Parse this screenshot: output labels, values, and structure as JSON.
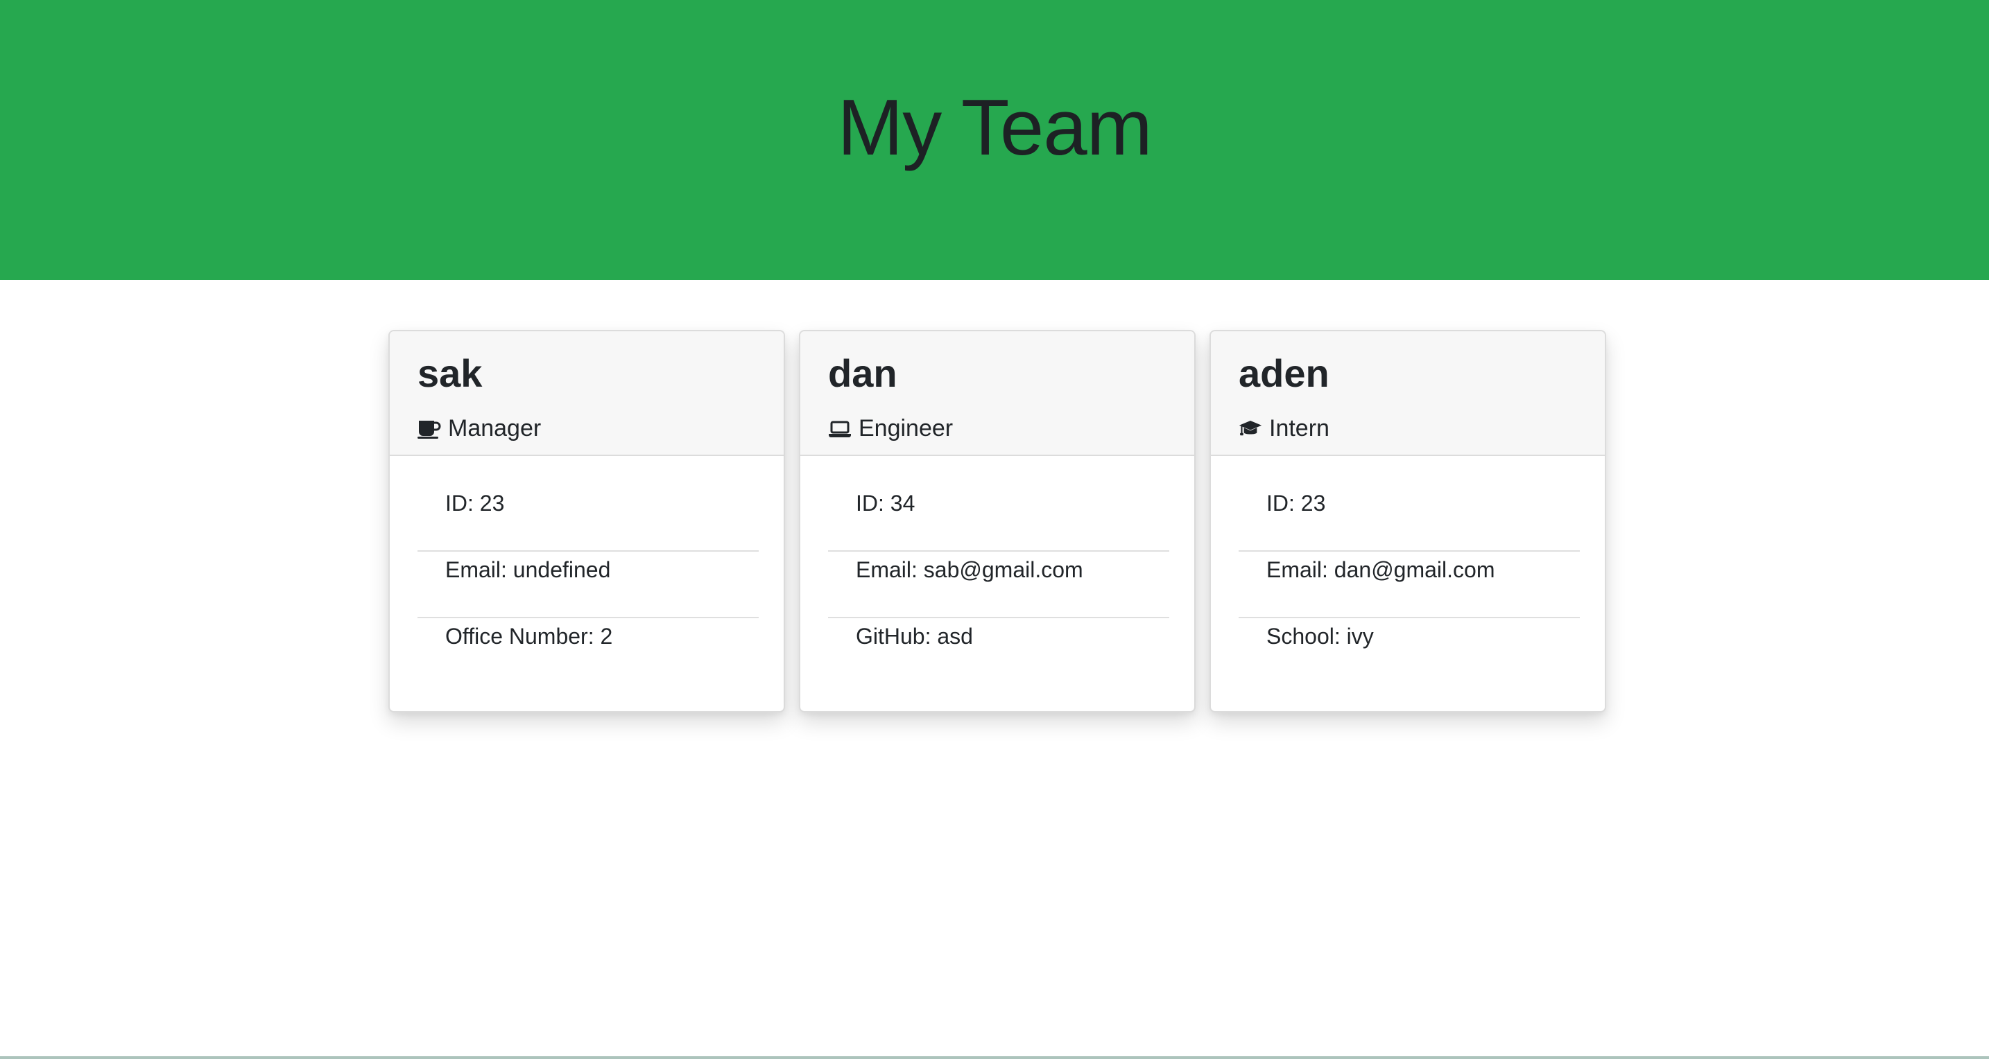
{
  "header": {
    "title": "My Team"
  },
  "colors": {
    "hero_background": "#26a84f",
    "card_header_background": "#f7f7f7"
  },
  "team": [
    {
      "name": "sak",
      "role": "Manager",
      "role_icon": "coffee-mug-icon",
      "details": [
        {
          "label": "ID: ",
          "value": "23"
        },
        {
          "label": "Email: ",
          "value": "undefined"
        },
        {
          "label": "Office Number: ",
          "value": "2"
        }
      ]
    },
    {
      "name": "dan",
      "role": "Engineer",
      "role_icon": "laptop-icon",
      "details": [
        {
          "label": "ID: ",
          "value": "34"
        },
        {
          "label": "Email: ",
          "value": "sab@gmail.com"
        },
        {
          "label": "GitHub: ",
          "value": "asd"
        }
      ]
    },
    {
      "name": "aden",
      "role": "Intern",
      "role_icon": "graduation-cap-icon",
      "details": [
        {
          "label": "ID: ",
          "value": "23"
        },
        {
          "label": "Email: ",
          "value": "dan@gmail.com"
        },
        {
          "label": "School: ",
          "value": "ivy"
        }
      ]
    }
  ]
}
